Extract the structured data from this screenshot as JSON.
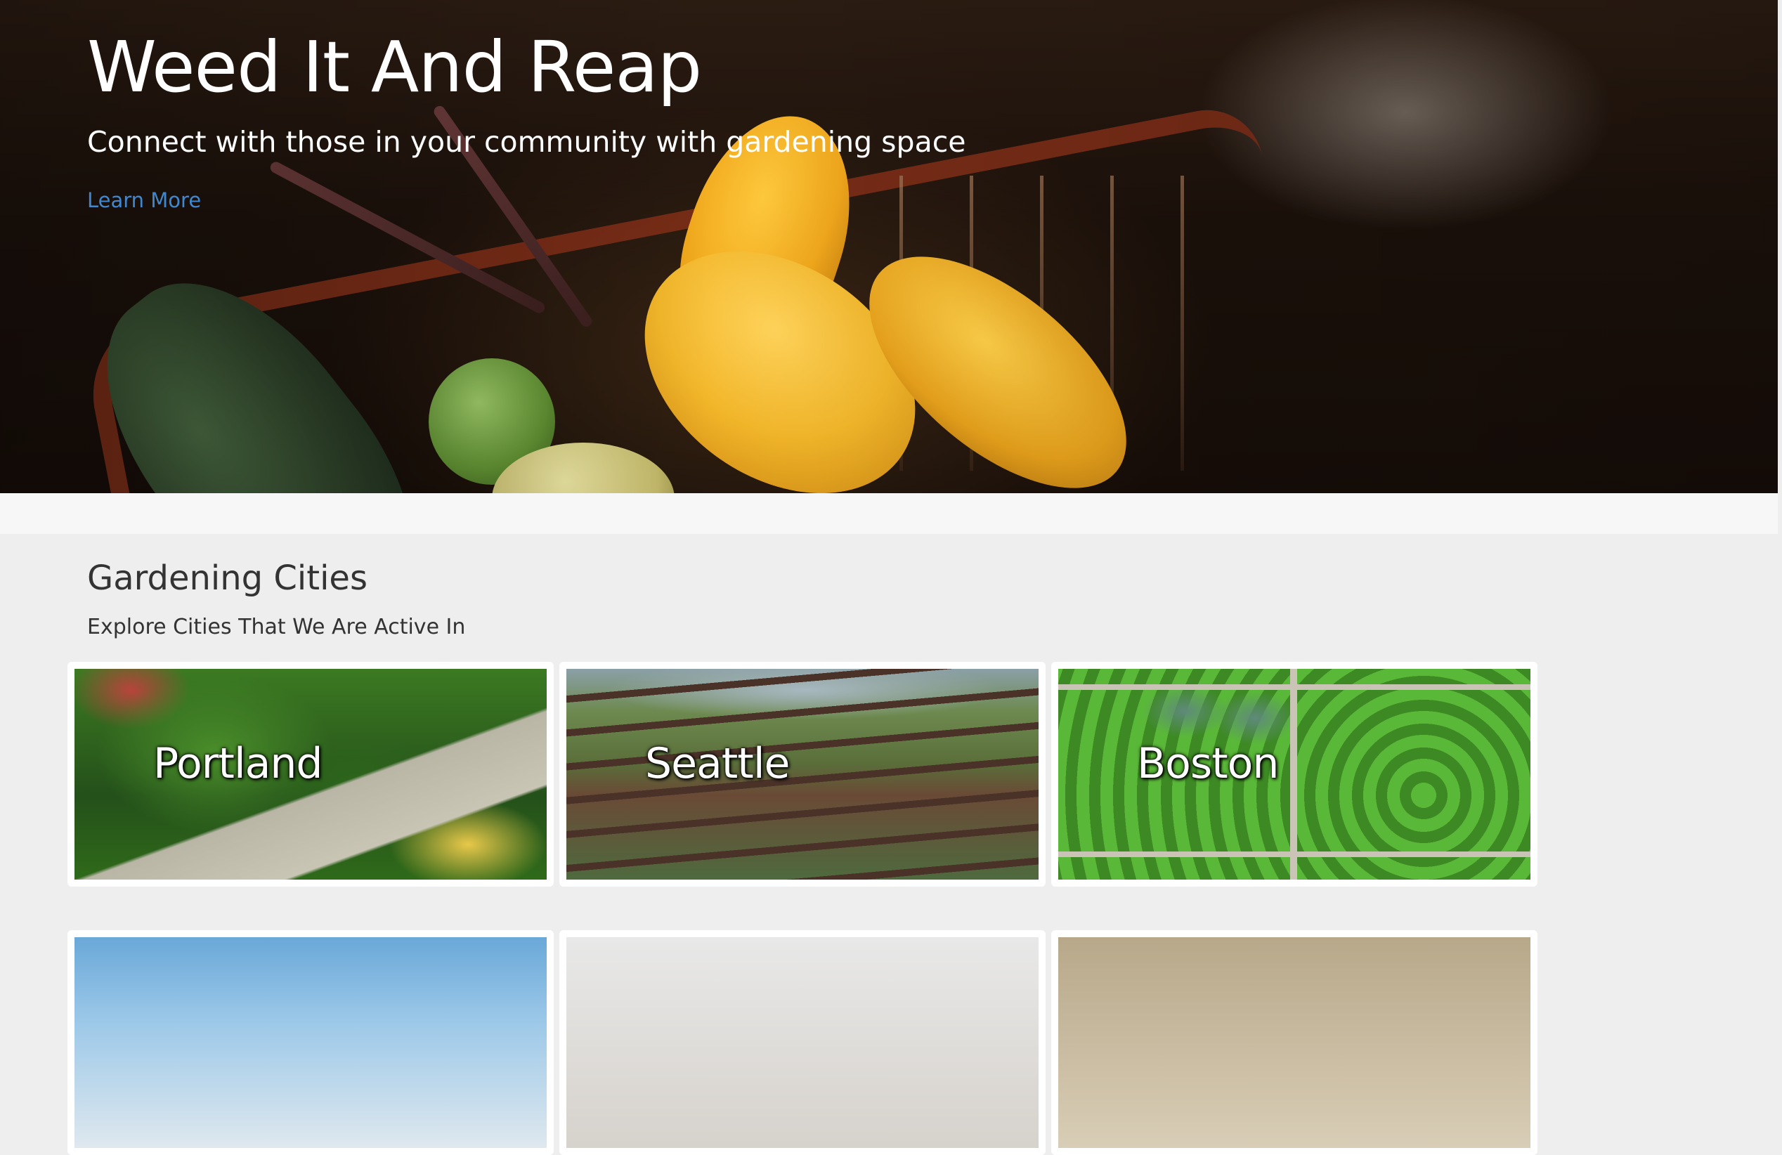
{
  "hero": {
    "title": "Weed It And Reap",
    "subtitle": "Connect with those in your community with gardening space",
    "link_label": "Learn More"
  },
  "section": {
    "title": "Gardening Cities",
    "subtitle": "Explore Cities That We Are Active In"
  },
  "cities": [
    {
      "name": "Portland"
    },
    {
      "name": "Seattle"
    },
    {
      "name": "Boston"
    }
  ],
  "colors": {
    "page_bg": "#eeeeee",
    "band_bg": "#f7f7f7",
    "link": "#3f88cf",
    "text": "#333333"
  }
}
